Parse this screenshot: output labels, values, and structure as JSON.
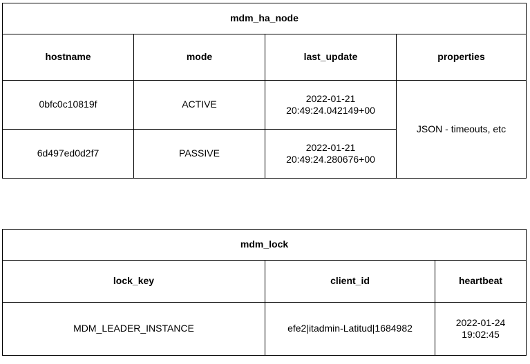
{
  "table1": {
    "title": "mdm_ha_node",
    "headers": [
      "hostname",
      "mode",
      "last_update",
      "properties"
    ],
    "rows": [
      {
        "hostname": "0bfc0c10819f",
        "mode": "ACTIVE",
        "last_update": "2022-01-21 20:49:24.042149+00"
      },
      {
        "hostname": "6d497ed0d2f7",
        "mode": "PASSIVE",
        "last_update": "2022-01-21 20:49:24.280676+00"
      }
    ],
    "properties_merged": "JSON - timeouts, etc"
  },
  "table2": {
    "title": "mdm_lock",
    "headers": [
      "lock_key",
      "client_id",
      "heartbeat"
    ],
    "rows": [
      {
        "lock_key": "MDM_LEADER_INSTANCE",
        "client_id": "efe2|itadmin-Latitud|1684982",
        "heartbeat": "2022-01-24 19:02:45"
      }
    ]
  }
}
